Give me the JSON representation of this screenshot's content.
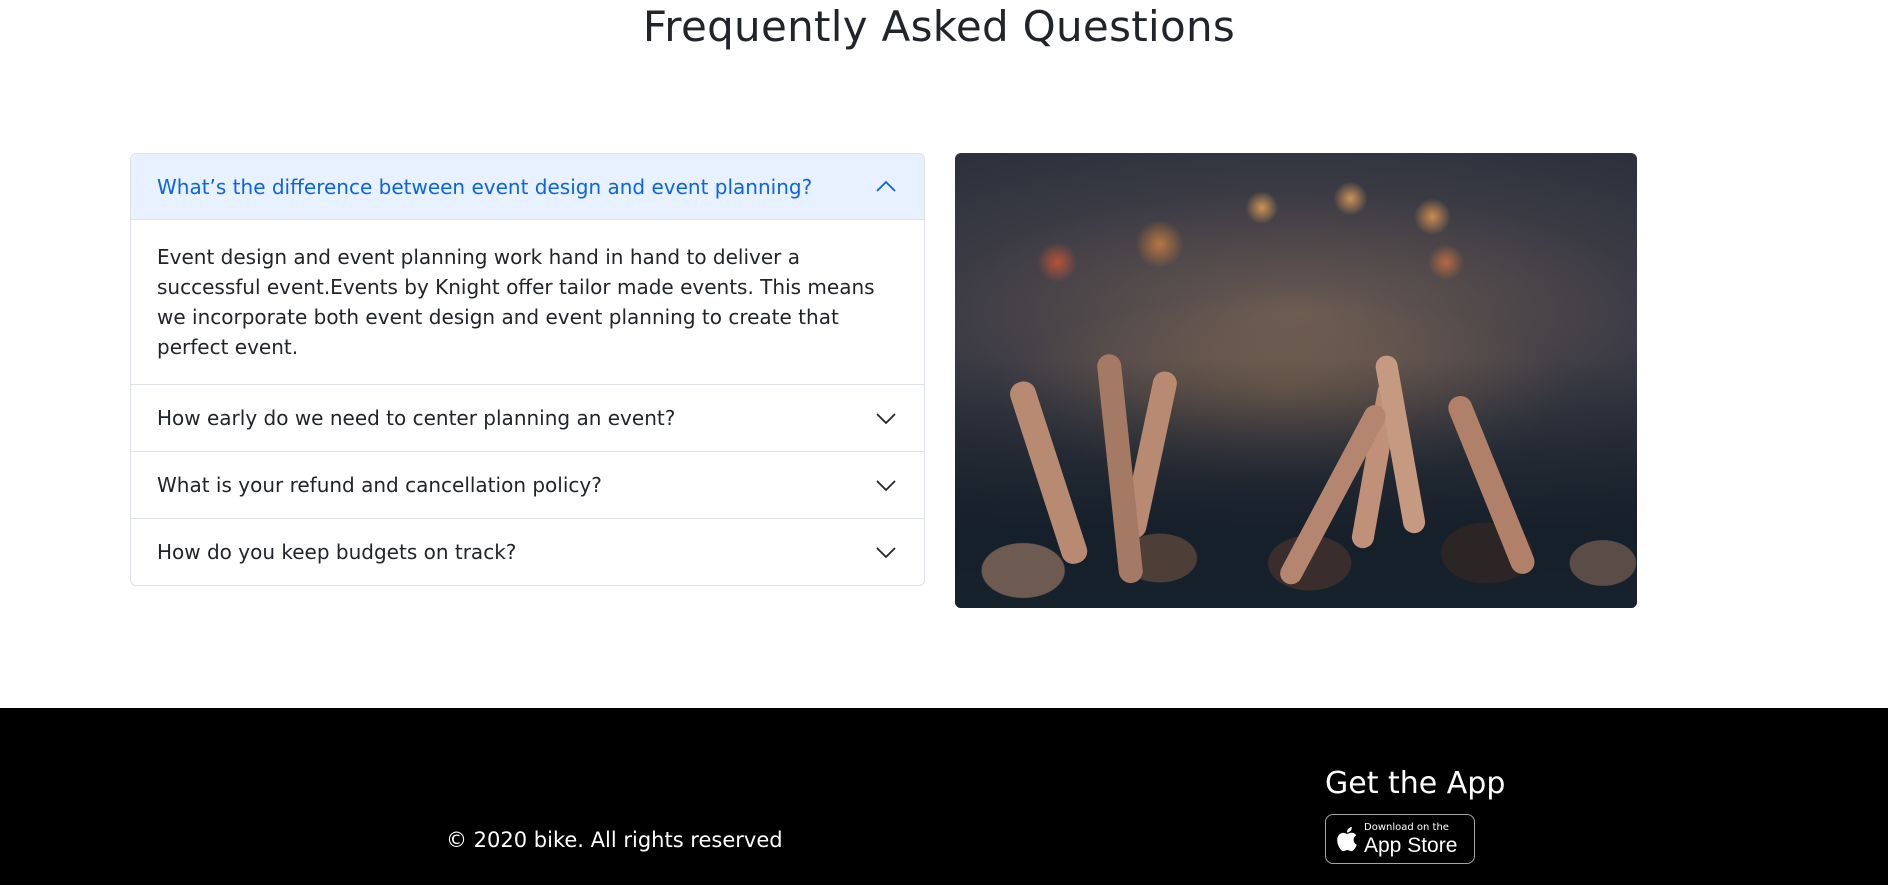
{
  "faq": {
    "title": "Frequently Asked Questions",
    "items": [
      {
        "question": "What’s the difference between event design and event planning?",
        "answer": "Event design and event planning work hand in hand to deliver a successful event.Events by Knight offer tailor made events. This means we incorporate both event design and event planning to create that perfect event.",
        "expanded": true
      },
      {
        "question": "How early do we need to center planning an event?",
        "expanded": false
      },
      {
        "question": "What is your refund and cancellation policy?",
        "expanded": false
      },
      {
        "question": "How do you keep budgets on track?",
        "expanded": false
      }
    ]
  },
  "footer": {
    "copyright": "© 2020 bike. All rights reserved",
    "get_app_title": "Get the App",
    "app_store_small": "Download on the",
    "app_store_large": "App Store"
  },
  "colors": {
    "active_header_bg": "#e7f1ff",
    "active_header_text": "#0c63e4",
    "footer_bg": "#000000"
  },
  "icons": {
    "expanded": "chevron-up-icon",
    "collapsed": "chevron-down-icon",
    "app_store": "apple-icon"
  }
}
